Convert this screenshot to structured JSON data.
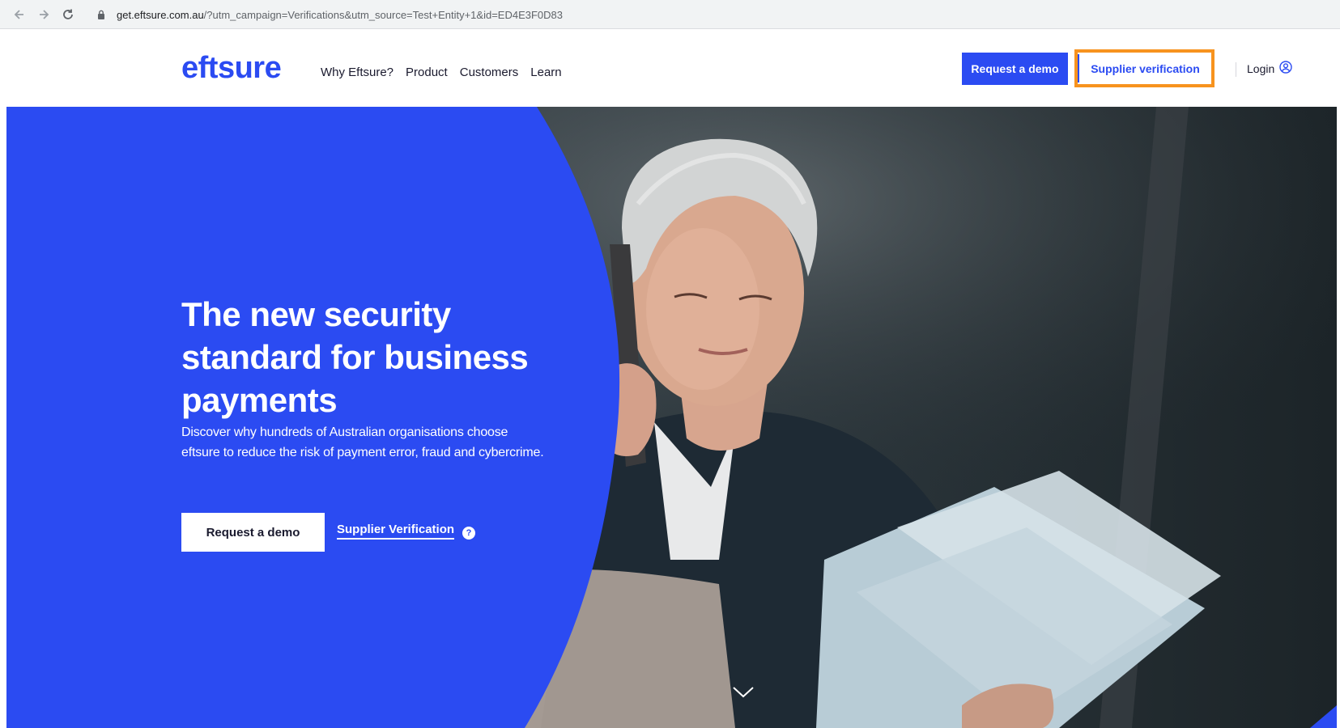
{
  "browser": {
    "url_host": "get.eftsure.com.au",
    "url_rest": "/?utm_campaign=Verifications&utm_source=Test+Entity+1&id=ED4E3F0D83"
  },
  "header": {
    "logo": "eftsure",
    "nav_items": [
      "Why Eftsure?",
      "Product",
      "Customers",
      "Learn"
    ],
    "request_demo_label": "Request a demo",
    "supplier_verification_label": "Supplier verification",
    "login_label": "Login"
  },
  "hero": {
    "title": "The new security standard for business payments",
    "subtitle": "Discover why hundreds of Australian organisations choose eftsure to reduce the risk of payment error, fraud and cybercrime.",
    "request_demo_label": "Request a demo",
    "supplier_verification_label": "Supplier Verification",
    "help_glyph": "?"
  },
  "colors": {
    "brand_blue": "#2b4bf2",
    "highlight_orange": "#f7931e"
  }
}
